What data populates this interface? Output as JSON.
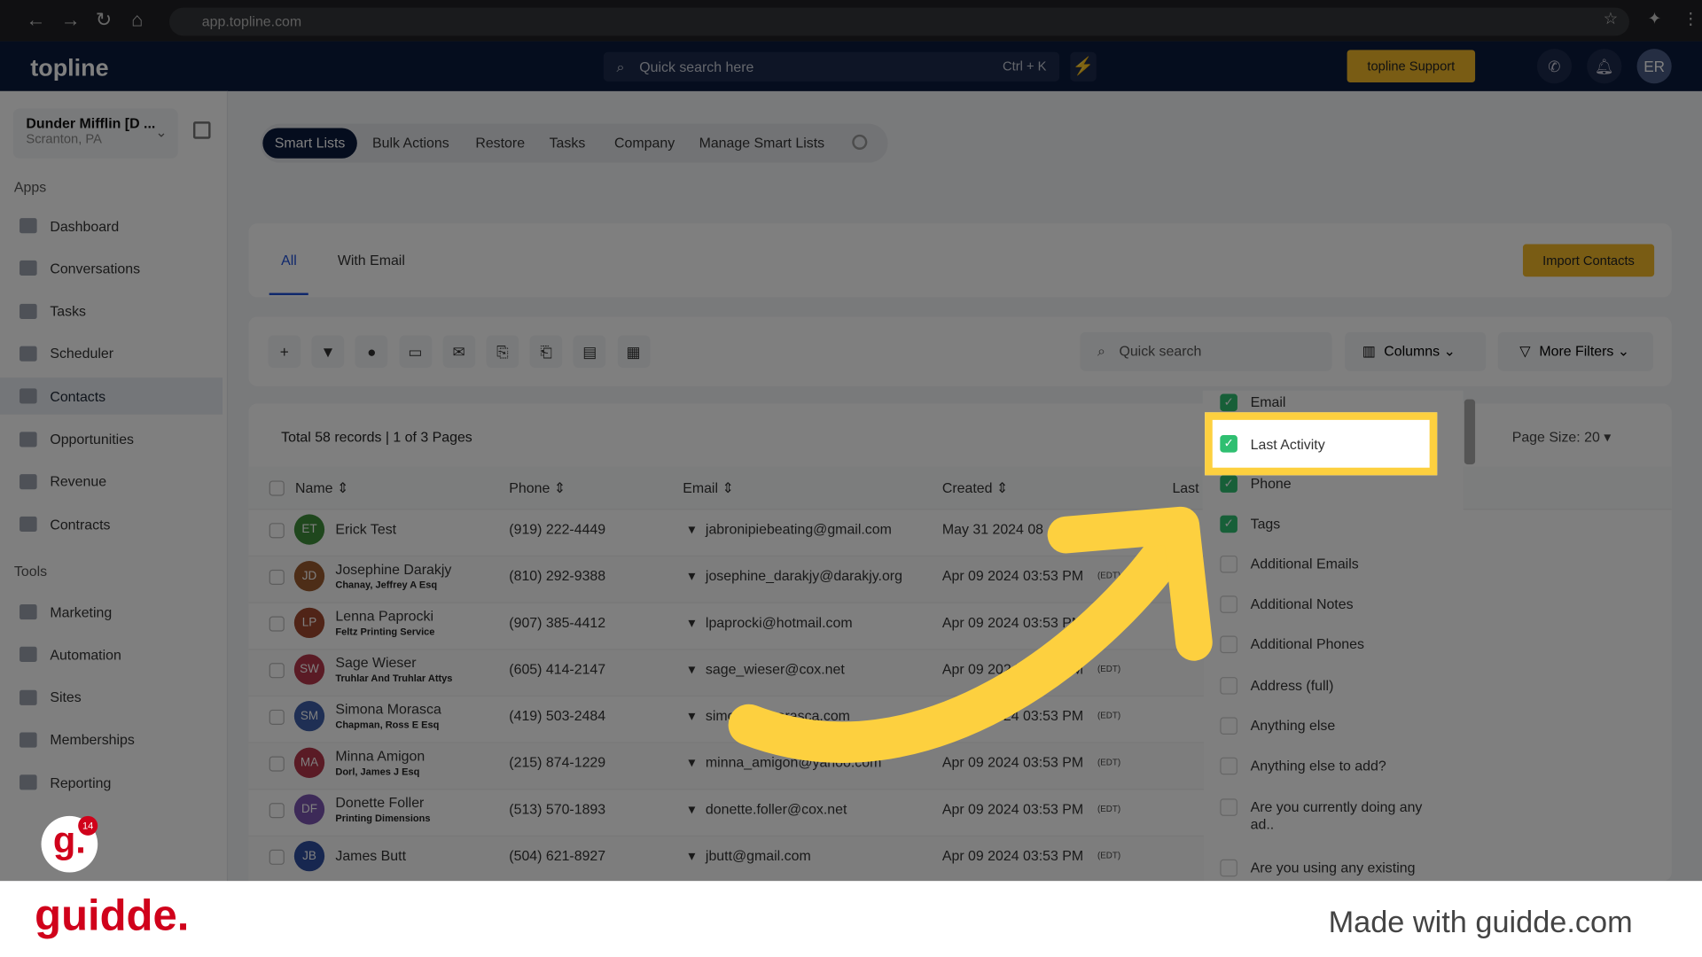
{
  "browser": {
    "url": "app.topline.com"
  },
  "topbar": {
    "logo": "topline",
    "search_placeholder": "Quick search here",
    "search_shortcut": "Ctrl + K",
    "support": "topline Support",
    "avatar": "ER"
  },
  "account": {
    "name": "Dunder Mifflin [D ...",
    "location": "Scranton, PA"
  },
  "sidebar": {
    "apps_label": "Apps",
    "tools_label": "Tools",
    "apps": [
      {
        "label": "Dashboard"
      },
      {
        "label": "Conversations"
      },
      {
        "label": "Tasks"
      },
      {
        "label": "Scheduler"
      },
      {
        "label": "Contacts",
        "active": true
      },
      {
        "label": "Opportunities"
      },
      {
        "label": "Revenue"
      },
      {
        "label": "Contracts"
      }
    ],
    "tools": [
      {
        "label": "Marketing"
      },
      {
        "label": "Automation"
      },
      {
        "label": "Sites"
      },
      {
        "label": "Memberships"
      },
      {
        "label": "Reporting"
      }
    ]
  },
  "subnav": [
    "Smart Lists",
    "Bulk Actions",
    "Restore",
    "Tasks",
    "Company",
    "Manage Smart Lists"
  ],
  "tabs": [
    "All",
    "With Email"
  ],
  "import_button": "Import Contacts",
  "toolbar": {
    "search_placeholder": "Quick search",
    "columns": "Columns",
    "more_filters": "More Filters"
  },
  "table": {
    "summary": "Total 58 records | 1 of 3 Pages",
    "page_size": "Page Size: 20",
    "headers": [
      "Name",
      "Phone",
      "Email",
      "Created",
      "Last"
    ],
    "rows": [
      {
        "initials": "ET",
        "color": "#3f8f3a",
        "name": "Erick Test",
        "company": "",
        "phone": "(919) 222-4449",
        "email": "jabronipiebeating@gmail.com",
        "created": "May 31 2024 08",
        "tz": ""
      },
      {
        "initials": "JD",
        "color": "#9a5a2e",
        "name": "Josephine Darakjy",
        "company": "Chanay, Jeffrey A Esq",
        "phone": "(810) 292-9388",
        "email": "josephine_darakjy@darakjy.org",
        "created": "Apr 09 2024 03:53 PM",
        "tz": "(EDT)"
      },
      {
        "initials": "LP",
        "color": "#a0482e",
        "name": "Lenna Paprocki",
        "company": "Feltz Printing Service",
        "phone": "(907) 385-4412",
        "email": "lpaprocki@hotmail.com",
        "created": "Apr 09 2024 03:53 PM",
        "tz": "(EDT)"
      },
      {
        "initials": "SW",
        "color": "#b5364a",
        "name": "Sage Wieser",
        "company": "Truhlar And Truhlar Attys",
        "phone": "(605) 414-2147",
        "email": "sage_wieser@cox.net",
        "created": "Apr 09 2024 03:53 PM",
        "tz": "(EDT)"
      },
      {
        "initials": "SM",
        "color": "#3f5fa8",
        "name": "Simona Morasca",
        "company": "Chapman, Ross E Esq",
        "phone": "(419) 503-2484",
        "email": "simona@morasca.com",
        "created": "Apr 09 2024 03:53 PM",
        "tz": "(EDT)"
      },
      {
        "initials": "MA",
        "color": "#b5364a",
        "name": "Minna Amigon",
        "company": "Dorl, James J Esq",
        "phone": "(215) 874-1229",
        "email": "minna_amigon@yahoo.com",
        "created": "Apr 09 2024 03:53 PM",
        "tz": "(EDT)"
      },
      {
        "initials": "DF",
        "color": "#7a55b0",
        "name": "Donette Foller",
        "company": "Printing Dimensions",
        "phone": "(513) 570-1893",
        "email": "donette.foller@cox.net",
        "created": "Apr 09 2024 03:53 PM",
        "tz": "(EDT)"
      },
      {
        "initials": "JB",
        "color": "#2f4ea0",
        "name": "James Butt",
        "company": "",
        "phone": "(504) 621-8927",
        "email": "jbutt@gmail.com",
        "created": "Apr 09 2024 03:53 PM",
        "tz": "(EDT)"
      }
    ]
  },
  "columns_dropdown": [
    {
      "label": "Email",
      "checked": true
    },
    {
      "label": "Last Activity",
      "checked": true,
      "highlighted": true
    },
    {
      "label": "Phone",
      "checked": true
    },
    {
      "label": "Tags",
      "checked": true
    },
    {
      "label": "Additional Emails",
      "checked": false
    },
    {
      "label": "Additional Notes",
      "checked": false
    },
    {
      "label": "Additional Phones",
      "checked": false
    },
    {
      "label": "Address (full)",
      "checked": false
    },
    {
      "label": "Anything else",
      "checked": false
    },
    {
      "label": "Anything else to add?",
      "checked": false
    },
    {
      "label": "Are you currently doing any ad..",
      "checked": false
    },
    {
      "label": "Are you using any existing",
      "checked": false
    }
  ],
  "footer": {
    "brand": "guidde.",
    "made_with": "Made with guidde.com",
    "badge_count": "14"
  },
  "colors": {
    "accent": "#fdd03f",
    "brand_red": "#d0021b",
    "navy": "#0b1a3d",
    "check_green": "#2fbf71"
  }
}
